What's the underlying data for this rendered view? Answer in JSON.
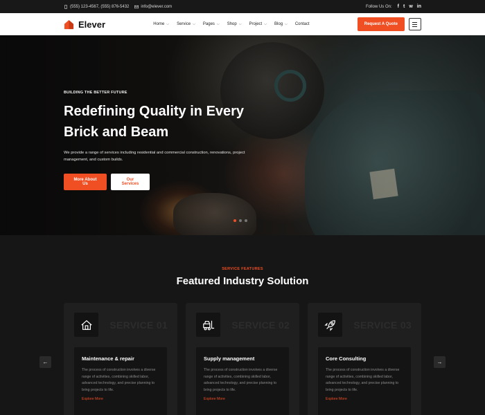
{
  "topbar": {
    "phone": "(555) 123-4567, (555) 876-5432",
    "email": "info@elever.com",
    "follow_label": "Follow Us On:",
    "social": [
      "f",
      "t",
      "w",
      "in"
    ]
  },
  "nav": {
    "brand": "Elever",
    "menu": [
      {
        "label": "Home",
        "dropdown": true
      },
      {
        "label": "Service",
        "dropdown": true
      },
      {
        "label": "Pages",
        "dropdown": true
      },
      {
        "label": "Shop",
        "dropdown": true
      },
      {
        "label": "Project",
        "dropdown": true
      },
      {
        "label": "Blog",
        "dropdown": true
      },
      {
        "label": "Contact",
        "dropdown": false
      }
    ],
    "cta": "Request A Quote"
  },
  "hero": {
    "eyebrow": "BUILDING THE BETTER FUTURE",
    "title": "Redefining Quality in Every Brick and Beam",
    "description": "We provide a range of services including residential and commercial construction, renovations, project management, and custom builds.",
    "primary_cta": "More About Us",
    "secondary_cta": "Our Services",
    "slides": 3,
    "active_slide": 1
  },
  "services": {
    "eyebrow": "SERVICE FEATURES",
    "title": "Featured Industry Solution",
    "cards": [
      {
        "icon": "house-repair-icon",
        "ghost": "SERVICE 01",
        "title": "Maintenance & repair",
        "desc": "The process of construction involves a diverse range of activities, combining skilled labor, advanced technology, and precise planning to bring projects to life.",
        "link": "Explore More"
      },
      {
        "icon": "forklift-icon",
        "ghost": "SERVICE 02",
        "title": "Supply management",
        "desc": "The process of construction involves a diverse range of activities, combining skilled labor, advanced technology, and precise planning to bring projects to life.",
        "link": "Explore More"
      },
      {
        "icon": "rocket-icon",
        "ghost": "SERVICE 03",
        "title": "Core Consulting",
        "desc": "The process of construction involves a diverse range of activities, combining skilled labor, advanced technology, and precise planning to bring projects to life.",
        "link": "Explore More"
      }
    ]
  },
  "colors": {
    "accent": "#f04e23",
    "dark": "#161616",
    "card": "#1f1f1f"
  }
}
